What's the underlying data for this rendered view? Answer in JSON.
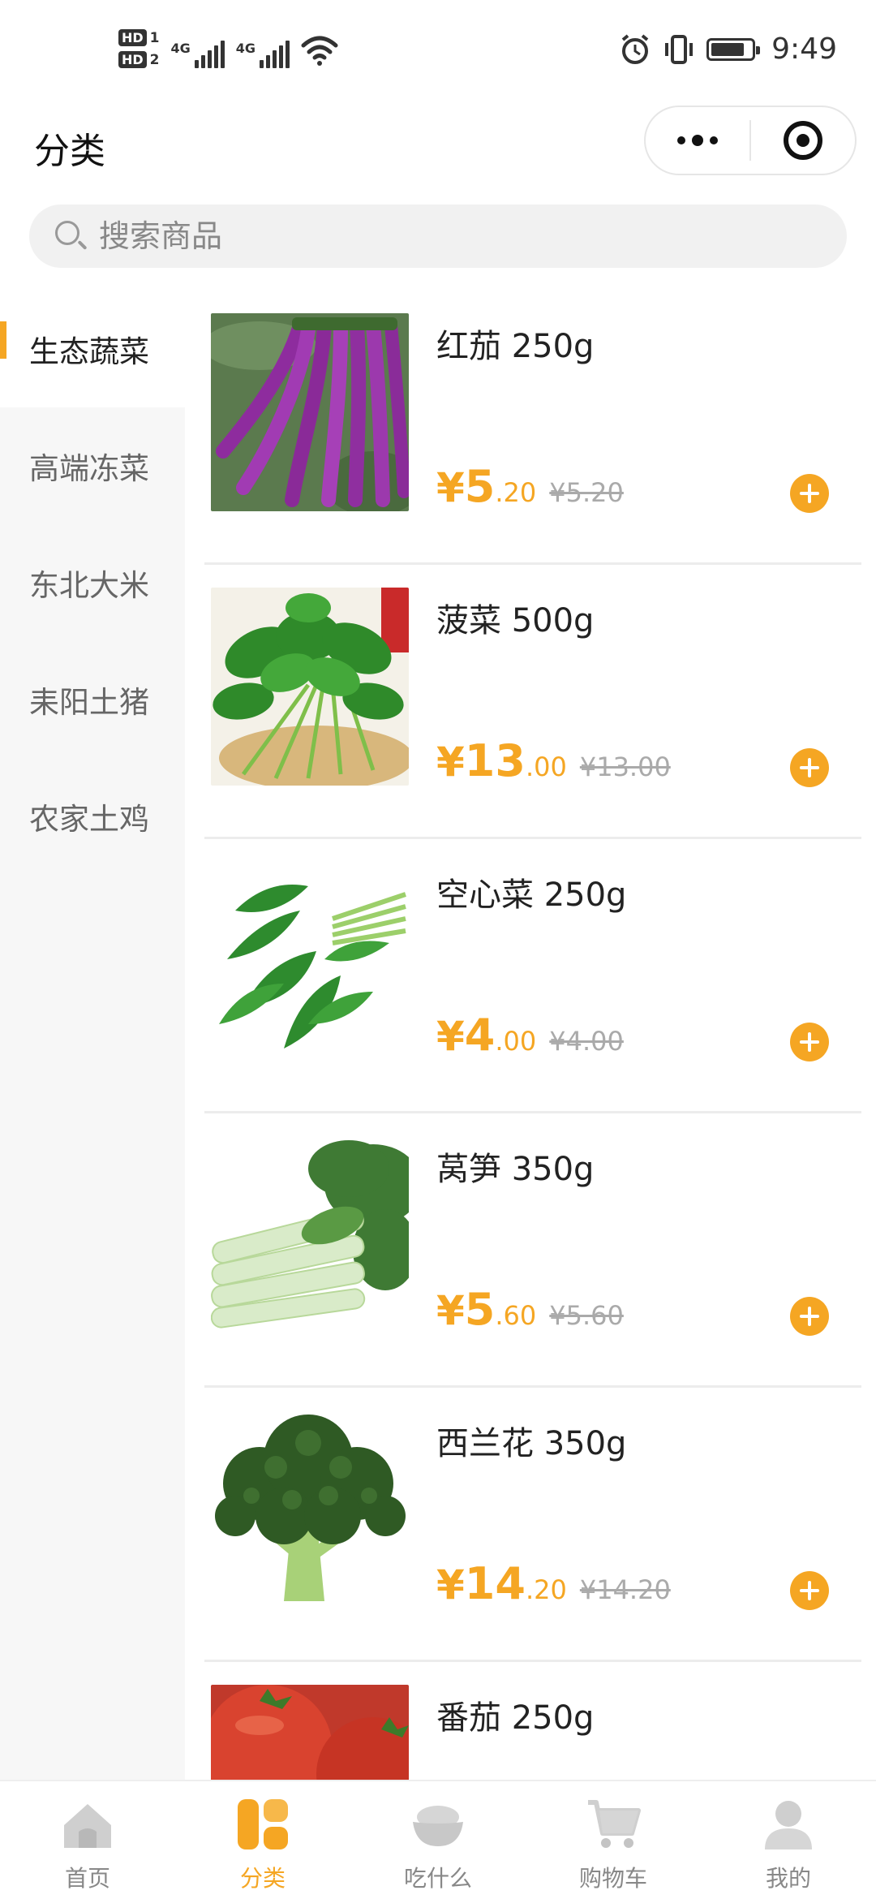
{
  "status_bar": {
    "hd1": "HD",
    "hd1_sub": "1",
    "hd2": "HD",
    "hd2_sub": "2",
    "net1": "4G",
    "net2": "4G",
    "time": "9:49",
    "icons": [
      "alarm-icon",
      "vibrate-icon",
      "battery-icon",
      "wifi-icon",
      "signal-icon"
    ]
  },
  "header": {
    "title": "分类"
  },
  "search": {
    "placeholder": "搜索商品"
  },
  "sidebar": {
    "items": [
      {
        "label": "生态蔬菜",
        "active": true
      },
      {
        "label": "高端冻菜",
        "active": false
      },
      {
        "label": "东北大米",
        "active": false
      },
      {
        "label": "耒阳土猪",
        "active": false
      },
      {
        "label": "农家土鸡",
        "active": false
      }
    ]
  },
  "products": [
    {
      "name": "红茄 250g",
      "symbol": "¥",
      "int": "5",
      "dec": ".20",
      "old": "¥5.20",
      "image": "eggplant"
    },
    {
      "name": "菠菜 500g",
      "symbol": "¥",
      "int": "13",
      "dec": ".00",
      "old": "¥13.00",
      "image": "spinach"
    },
    {
      "name": "空心菜 250g",
      "symbol": "¥",
      "int": "4",
      "dec": ".00",
      "old": "¥4.00",
      "image": "water-spinach"
    },
    {
      "name": "莴笋 350g",
      "symbol": "¥",
      "int": "5",
      "dec": ".60",
      "old": "¥5.60",
      "image": "lettuce-stem"
    },
    {
      "name": "西兰花 350g",
      "symbol": "¥",
      "int": "14",
      "dec": ".20",
      "old": "¥14.20",
      "image": "broccoli"
    },
    {
      "name": "番茄 250g",
      "symbol": "¥",
      "int": "",
      "dec": "",
      "old": "",
      "image": "tomato"
    }
  ],
  "tabbar": {
    "items": [
      {
        "label": "首页",
        "icon": "home-icon",
        "active": false
      },
      {
        "label": "分类",
        "icon": "category-icon",
        "active": true
      },
      {
        "label": "吃什么",
        "icon": "bowl-icon",
        "active": false
      },
      {
        "label": "购物车",
        "icon": "cart-icon",
        "active": false
      },
      {
        "label": "我的",
        "icon": "user-icon",
        "active": false
      }
    ]
  },
  "colors": {
    "accent": "#f5a623",
    "sidebar_bg": "#f7f7f7",
    "search_bg": "#f1f1f1"
  }
}
